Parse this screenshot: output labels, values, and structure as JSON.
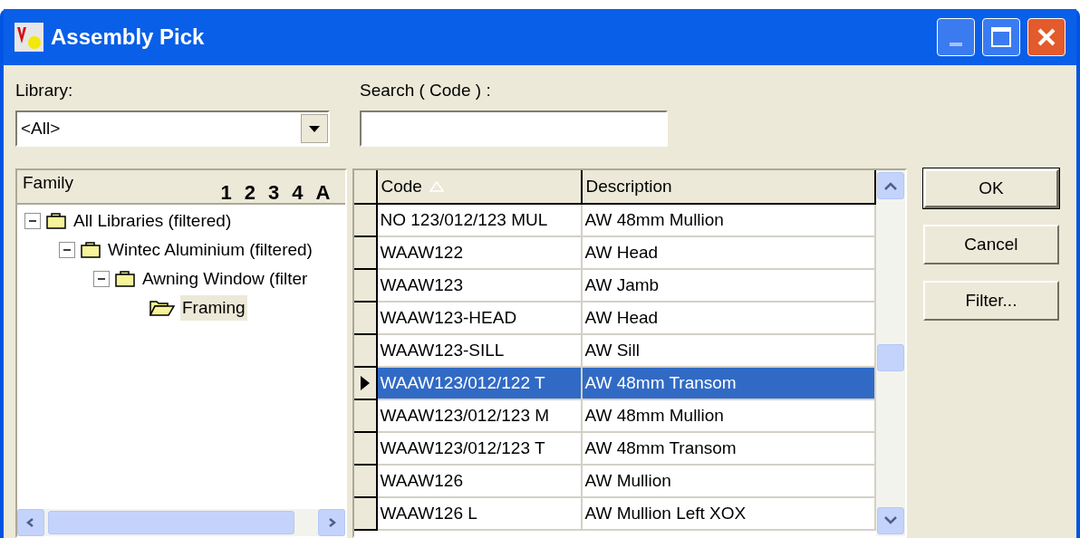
{
  "window": {
    "title": "Assembly Pick"
  },
  "library": {
    "label": "Library:",
    "value": "<All>"
  },
  "search": {
    "label": "Search ( Code ) :"
  },
  "family": {
    "label": "Family",
    "levels": [
      "1",
      "2",
      "3",
      "4",
      "A"
    ],
    "tree": [
      {
        "label": "All Libraries (filtered)",
        "expanded": true,
        "selected": false,
        "children": [
          {
            "label": "Wintec Aluminium (filtered)",
            "expanded": true,
            "selected": false,
            "children": [
              {
                "label": "Awning Window (filter",
                "expanded": true,
                "selected": false,
                "children": [
                  {
                    "label": "Framing",
                    "selected": true
                  }
                ]
              }
            ]
          }
        ]
      }
    ]
  },
  "table": {
    "columns": [
      "Code",
      "Description"
    ],
    "rows": [
      {
        "cells": [
          "NO 123/012/123 MUL",
          "AW 48mm Mullion"
        ],
        "selected": false
      },
      {
        "cells": [
          "WAAW122",
          "AW Head"
        ],
        "selected": false
      },
      {
        "cells": [
          "WAAW123",
          "AW Jamb"
        ],
        "selected": false
      },
      {
        "cells": [
          "WAAW123-HEAD",
          "AW Head"
        ],
        "selected": false
      },
      {
        "cells": [
          "WAAW123-SILL",
          "AW Sill"
        ],
        "selected": false
      },
      {
        "cells": [
          "WAAW123/012/122 T",
          "AW 48mm Transom"
        ],
        "selected": true
      },
      {
        "cells": [
          "WAAW123/012/123 M",
          "AW 48mm Mullion"
        ],
        "selected": false
      },
      {
        "cells": [
          "WAAW123/012/123 T",
          "AW 48mm Transom"
        ],
        "selected": false
      },
      {
        "cells": [
          "WAAW126",
          "AW Mullion"
        ],
        "selected": false
      },
      {
        "cells": [
          "WAAW126 L",
          "AW Mullion Left XOX"
        ],
        "selected": false
      }
    ]
  },
  "buttons": [
    {
      "label": "OK",
      "default": true
    },
    {
      "label": "Cancel",
      "default": false
    },
    {
      "label": "Filter...",
      "default": false
    }
  ]
}
